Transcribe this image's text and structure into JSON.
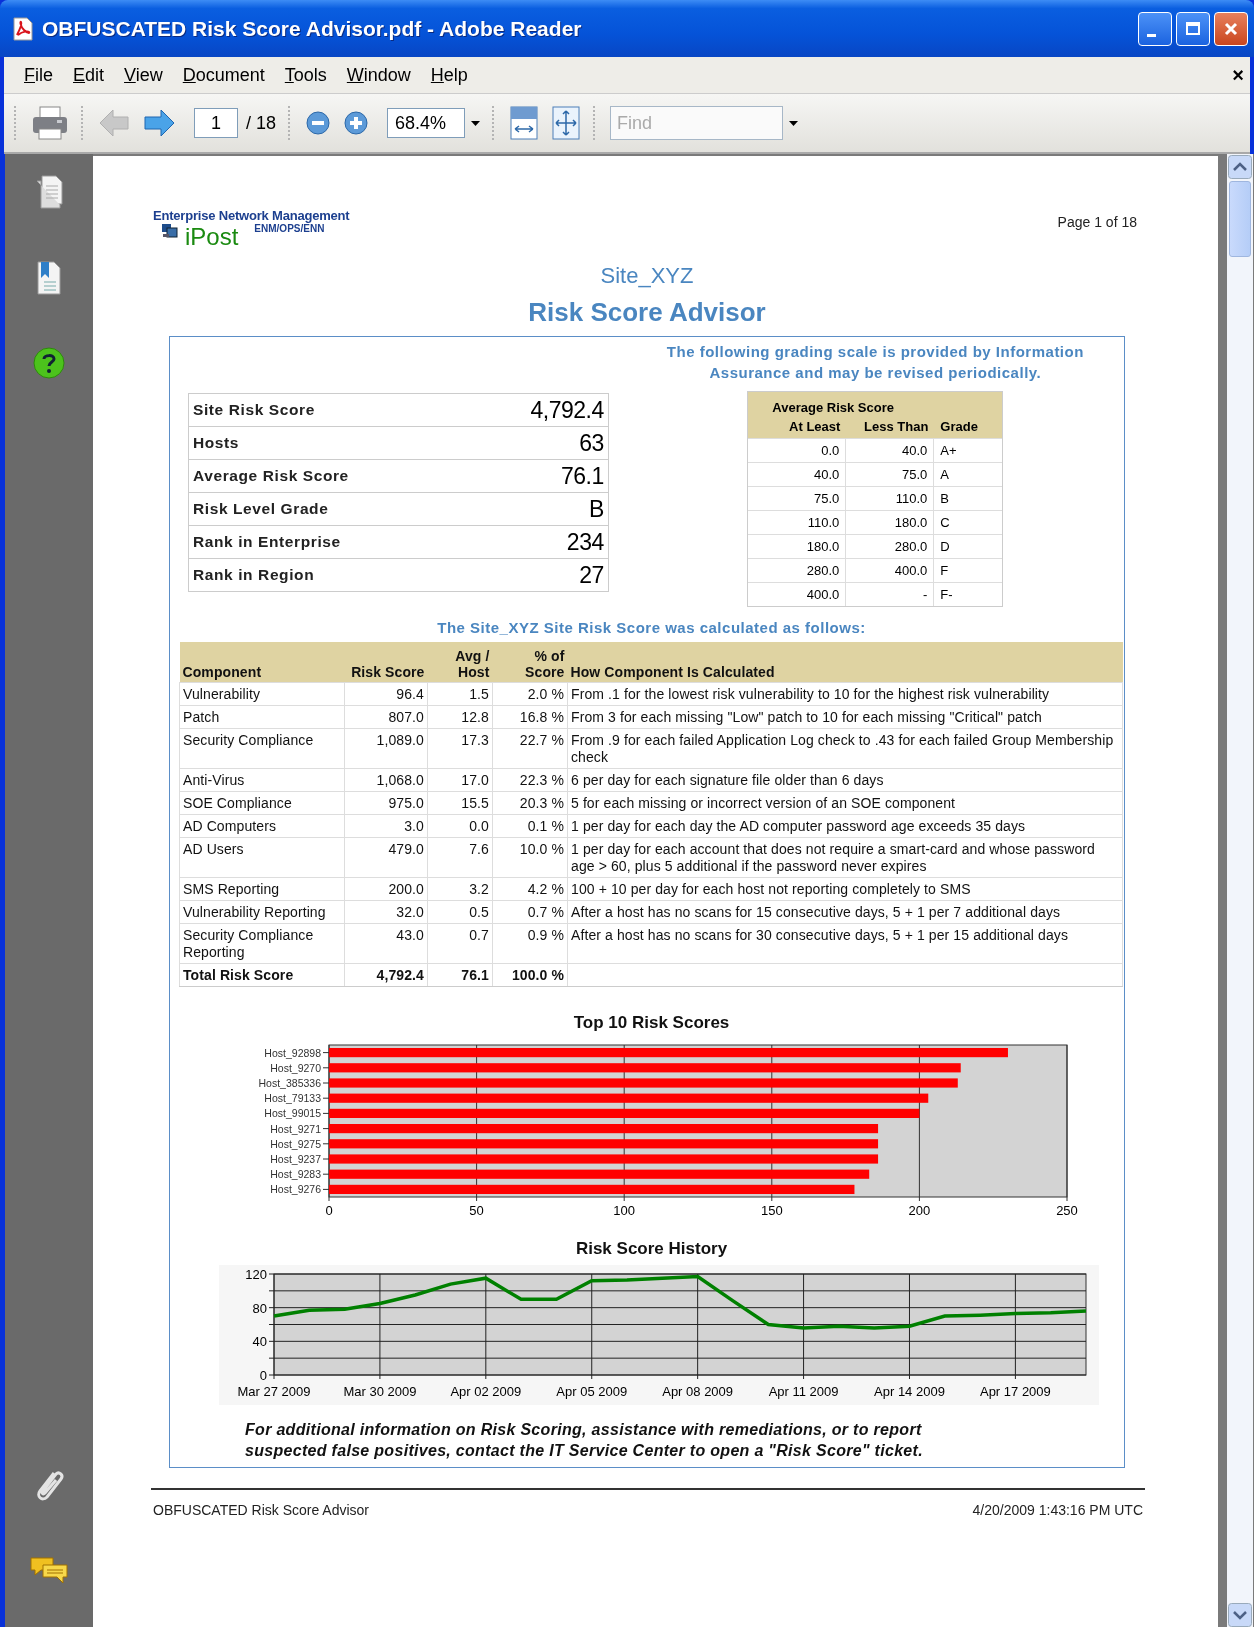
{
  "window": {
    "title": "OBFUSCATED Risk Score Advisor.pdf - Adobe Reader"
  },
  "menu": [
    "File",
    "Edit",
    "View",
    "Document",
    "Tools",
    "Window",
    "Help"
  ],
  "menu_close": "×",
  "toolbar": {
    "back_disabled": true,
    "page": "1",
    "page_total": "/ 18",
    "zoom": "68.4%",
    "find_placeholder": "Find"
  },
  "document": {
    "org": "Enterprise Network Management",
    "logo": "iPost",
    "org_sub": "ENM/OPS/ENN",
    "page_label": "Page 1 of 18",
    "site": "Site_XYZ",
    "title": "Risk Score Advisor",
    "grading_note": "The following grading scale is provided by Information Assurance and may be revised periodically.",
    "summary": [
      {
        "label": "Site Risk Score",
        "value": "4,792.4"
      },
      {
        "label": "Hosts",
        "value": "63"
      },
      {
        "label": "Average Risk Score",
        "value": "76.1"
      },
      {
        "label": "Risk Level Grade",
        "value": "B"
      },
      {
        "label": "Rank in Enterprise",
        "value": "234"
      },
      {
        "label": "Rank in Region",
        "value": "27"
      }
    ],
    "grade_table": {
      "caption": "Average Risk Score",
      "columns": [
        "At Least",
        "Less Than",
        "Grade"
      ],
      "rows": [
        [
          "0.0",
          "40.0",
          "A+"
        ],
        [
          "40.0",
          "75.0",
          "A"
        ],
        [
          "75.0",
          "110.0",
          "B"
        ],
        [
          "110.0",
          "180.0",
          "C"
        ],
        [
          "180.0",
          "280.0",
          "D"
        ],
        [
          "280.0",
          "400.0",
          "F"
        ],
        [
          "400.0",
          "-",
          "F-"
        ]
      ]
    },
    "calc_title": "The Site_XYZ Site Risk Score was calculated as follows:",
    "components": {
      "columns": [
        "Component",
        "Risk Score",
        "Avg / Host",
        "% of Score",
        "How Component Is Calculated"
      ],
      "rows": [
        {
          "component": "Vulnerability",
          "risk_score": "96.4",
          "avg_host": "1.5",
          "pct": "2.0 %",
          "how": "From .1 for the lowest risk vulnerability to 10 for the highest risk vulnerability"
        },
        {
          "component": "Patch",
          "risk_score": "807.0",
          "avg_host": "12.8",
          "pct": "16.8 %",
          "how": "From 3 for each missing \"Low\" patch to 10 for each missing \"Critical\" patch"
        },
        {
          "component": "Security Compliance",
          "risk_score": "1,089.0",
          "avg_host": "17.3",
          "pct": "22.7 %",
          "how": "From .9 for each failed Application Log check to .43 for each failed Group Membership check"
        },
        {
          "component": "Anti-Virus",
          "risk_score": "1,068.0",
          "avg_host": "17.0",
          "pct": "22.3 %",
          "how": "6 per day for each signature file older than 6 days"
        },
        {
          "component": "SOE Compliance",
          "risk_score": "975.0",
          "avg_host": "15.5",
          "pct": "20.3 %",
          "how": "5 for each missing or incorrect version of an SOE component"
        },
        {
          "component": "AD Computers",
          "risk_score": "3.0",
          "avg_host": "0.0",
          "pct": "0.1 %",
          "how": "1 per day for each day the AD computer password age exceeds 35 days"
        },
        {
          "component": "AD Users",
          "risk_score": "479.0",
          "avg_host": "7.6",
          "pct": "10.0 %",
          "how": "1 per day for each account that does not require a smart-card and whose password age > 60, plus 5 additional if the password never expires"
        },
        {
          "component": "SMS Reporting",
          "risk_score": "200.0",
          "avg_host": "3.2",
          "pct": "4.2 %",
          "how": "100 + 10 per day for each host not reporting completely to SMS"
        },
        {
          "component": "Vulnerability Reporting",
          "risk_score": "32.0",
          "avg_host": "0.5",
          "pct": "0.7 %",
          "how": "After a host has no scans for 15 consecutive days, 5 + 1 per 7 additional days"
        },
        {
          "component": "Security Compliance Reporting",
          "risk_score": "43.0",
          "avg_host": "0.7",
          "pct": "0.9 %",
          "how": "After a host has no scans for 30 consecutive days, 5 + 1 per 15 additional days"
        }
      ],
      "total": {
        "component": "Total Risk Score",
        "risk_score": "4,792.4",
        "avg_host": "76.1",
        "pct": "100.0 %"
      }
    },
    "top_chart": {
      "chart_data": {
        "type": "bar",
        "orientation": "horizontal",
        "title": "Top 10 Risk Scores",
        "categories": [
          "Host_92898",
          "Host_9270",
          "Host_385336",
          "Host_79133",
          "Host_99015",
          "Host_9271",
          "Host_9275",
          "Host_9237",
          "Host_9283",
          "Host_9276"
        ],
        "series": [
          {
            "color": "#ff0000",
            "values": [
              230,
              214,
              213,
              203,
              200,
              186,
              186,
              186,
              183,
              178
            ]
          }
        ],
        "xlim": [
          0,
          250
        ],
        "xticks": [
          0,
          50,
          100,
          150,
          200,
          250
        ],
        "grid": true
      }
    },
    "history_chart": {
      "chart_data": {
        "type": "line",
        "title": "Risk Score History",
        "categories": [
          "Mar 27 2009",
          null,
          null,
          "Mar 30 2009",
          null,
          null,
          "Apr 02 2009",
          null,
          null,
          "Apr 05 2009",
          null,
          null,
          "Apr 08 2009",
          null,
          null,
          "Apr 11 2009",
          null,
          null,
          "Apr 14 2009",
          null,
          null,
          "Apr 17 2009",
          null,
          null
        ],
        "grid": true,
        "series": [
          {
            "color": "#008000",
            "values": [
              70,
              77,
              78,
              85,
              95,
              108,
              115,
              90,
              90,
              112,
              113,
              115,
              117,
              88,
              60,
              56,
              58,
              56,
              58,
              70,
              71,
              73,
              74,
              76
            ]
          }
        ],
        "ylim": [
          0,
          120
        ],
        "yticks": [
          0,
          40,
          80,
          120
        ]
      }
    },
    "footnote": "For additional information on Risk Scoring, assistance with remediations, or to report suspected false positives, contact the IT Service Center to open a \"Risk Score\" ticket.",
    "footer_left": "OBFUSCATED Risk Score Advisor",
    "footer_right": "4/20/2009 1:43:16 PM UTC"
  }
}
